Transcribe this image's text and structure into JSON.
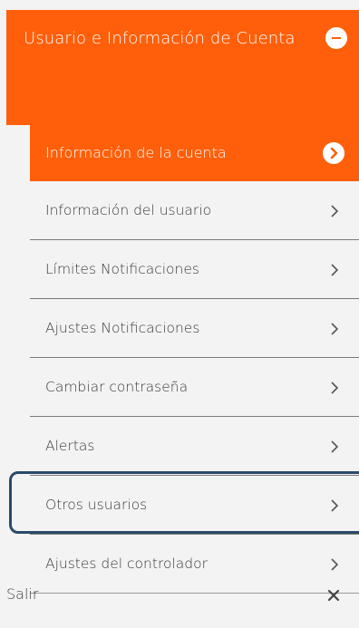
{
  "section": {
    "title": "Usuario e Información de Cuenta",
    "collapse_icon": "minus-circle-icon"
  },
  "active_item": {
    "label": "Información de la cuenta",
    "icon": "chevron-right-circle-icon"
  },
  "items": [
    {
      "label": "Información del usuario"
    },
    {
      "label": "Límites Notificaciones"
    },
    {
      "label": "Ajustes Notificaciones"
    },
    {
      "label": "Cambiar contraseña"
    },
    {
      "label": "Alertas"
    },
    {
      "label": "Otros usuarios",
      "highlighted": true
    },
    {
      "label": "Ajustes del controlador"
    }
  ],
  "logout": {
    "label": "Salir",
    "icon": "close-icon"
  },
  "colors": {
    "accent": "#ff5f0a",
    "highlight_border": "#2a4a6a",
    "background": "#f3f3f3",
    "text": "#3a3a3a"
  }
}
